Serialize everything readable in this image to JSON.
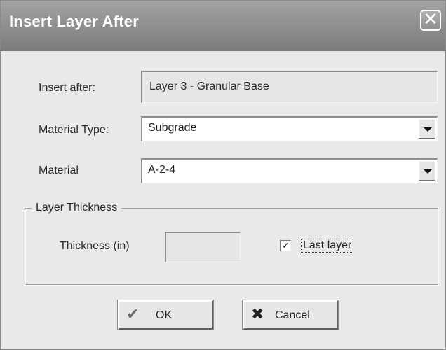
{
  "dialog": {
    "title": "Insert Layer After",
    "close_glyph": "✕"
  },
  "insert_after": {
    "label": "Insert after:",
    "value": "Layer 3 - Granular Base"
  },
  "material_type": {
    "label": "Material Type:",
    "value": "Subgrade"
  },
  "material": {
    "label": "Material",
    "value": "A-2-4"
  },
  "layer_thickness": {
    "group_label": "Layer Thickness",
    "thickness_label": "Thickness (in)",
    "thickness_value": "",
    "last_layer_label": "Last layer",
    "last_layer_checked": true,
    "check_glyph": "✓"
  },
  "buttons": {
    "ok_label": "OK",
    "ok_icon": "check-icon",
    "ok_glyph": "✔",
    "ok_color": "#6e6e6e",
    "cancel_label": "Cancel",
    "cancel_icon": "x-icon",
    "cancel_glyph": "✖",
    "cancel_color": "#222222"
  }
}
